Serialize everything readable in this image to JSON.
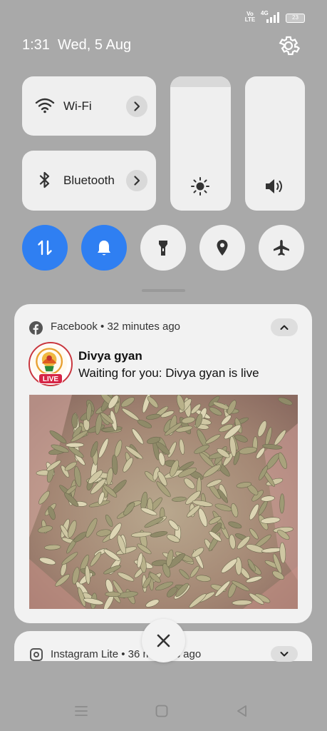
{
  "status_bar": {
    "volte": "Vo LTE",
    "network": "4G",
    "battery": "23"
  },
  "header": {
    "datetime": "1:31  Wed, 5 Aug"
  },
  "quick_settings": {
    "wifi_label": "Wi-Fi",
    "bluetooth_label": "Bluetooth",
    "brightness_level": 0.92,
    "colors": {
      "accent_on": "#2f7ff2",
      "tile_bg": "#efefef",
      "shade_bg": "#a9a9a9"
    },
    "round_toggles": [
      {
        "name": "mobile-data",
        "on": true
      },
      {
        "name": "ring-mode",
        "on": true
      },
      {
        "name": "flashlight",
        "on": false
      },
      {
        "name": "location",
        "on": false
      },
      {
        "name": "airplane-mode",
        "on": false
      }
    ]
  },
  "notifications": [
    {
      "app": "Facebook",
      "time": "32 minutes ago",
      "header": "Facebook • 32 minutes ago",
      "sender": "Divya gyan",
      "message": "Waiting for you: Divya gyan is live",
      "badge": "LIVE"
    },
    {
      "app": "Instagram Lite",
      "header": "Instagram Lite • 36 minutes ago"
    }
  ]
}
